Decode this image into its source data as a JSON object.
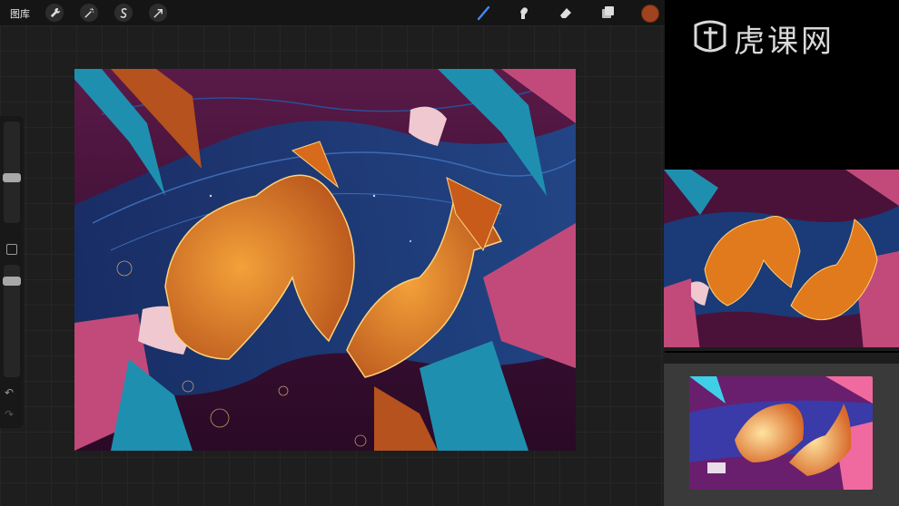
{
  "app": {
    "gallery_label": "图库",
    "active_color": "#a1431f"
  },
  "toolbar": {
    "left_tools": [
      "wrench-icon",
      "magic-wand-icon",
      "selection-s-icon",
      "move-arrow-icon"
    ],
    "right_tools": [
      "brush-icon",
      "smudge-icon",
      "eraser-icon",
      "layers-icon"
    ]
  },
  "sidebar": {
    "undo_glyph": "↶",
    "redo_glyph": "↷"
  },
  "watermark": {
    "text": "虎课网"
  },
  "colors": {
    "bg_purple": "#4a1238",
    "deep_blue": "#1b3a78",
    "koi_orange": "#e07a1c",
    "leaf_teal": "#1f8fb0",
    "leaf_pink": "#c24a7a"
  }
}
